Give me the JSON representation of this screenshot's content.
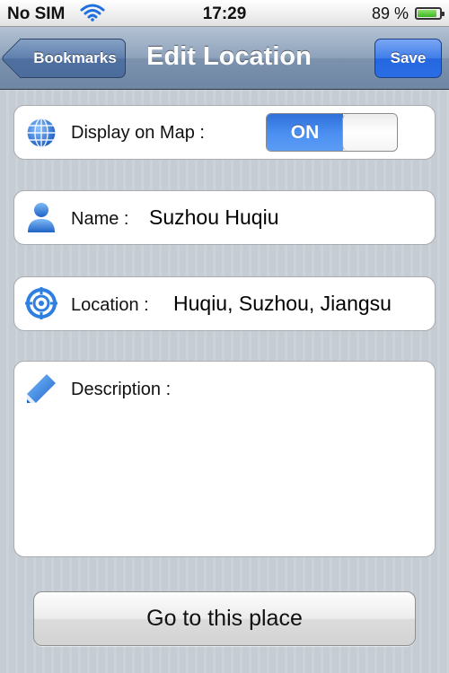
{
  "status_bar": {
    "carrier": "No SIM",
    "time": "17:29",
    "battery_percent": "89 %",
    "battery_level": 0.89
  },
  "nav_bar": {
    "back_label": "Bookmarks",
    "title": "Edit Location",
    "save_label": "Save"
  },
  "form": {
    "display_on_map": {
      "label": "Display on Map :",
      "toggle_text": "ON",
      "value": true,
      "icon": "globe-icon"
    },
    "name": {
      "label": "Name :",
      "value": "Suzhou Huqiu",
      "icon": "person-icon"
    },
    "location": {
      "label": "Location :",
      "value": "Huqiu, Suzhou, Jiangsu",
      "icon": "target-icon"
    },
    "description": {
      "label": "Description :",
      "value": "",
      "icon": "pencil-icon"
    }
  },
  "actions": {
    "go_label": "Go to this place"
  },
  "colors": {
    "nav_bar": "#8ea2ba",
    "accent_blue": "#2a6de4",
    "toggle_on": "#4a8ef0"
  }
}
